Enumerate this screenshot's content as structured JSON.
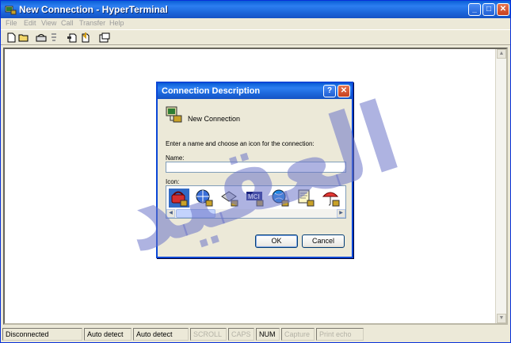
{
  "window": {
    "title": "New Connection - HyperTerminal",
    "minimize": "_",
    "maximize": "□",
    "close": "✕"
  },
  "menu": [
    "File",
    "Edit",
    "View",
    "Call",
    "Transfer",
    "Help"
  ],
  "toolbar": [
    "new-icon",
    "open-icon",
    "dial-icon",
    "disconnect-icon",
    "send-icon",
    "receive-icon",
    "properties-icon"
  ],
  "dialog": {
    "title": "Connection Description",
    "help": "?",
    "close": "✕",
    "connection_name": "New Connection",
    "prompt": "Enter a name and choose an icon for the connection:",
    "name_label": "Name:",
    "name_value": "",
    "icon_label": "Icon:",
    "icons": [
      "phone-red-icon",
      "globe-icon",
      "fax-icon",
      "mci-icon",
      "globe-blue-icon",
      "document-icon",
      "umbrella-icon"
    ],
    "ok_label": "OK",
    "cancel_label": "Cancel"
  },
  "status": {
    "connection": "Disconnected",
    "detect1": "Auto detect",
    "detect2": "Auto detect",
    "scroll": "SCROLL",
    "caps": "CAPS",
    "num": "NUM",
    "capture": "Capture",
    "print_echo": "Print echo"
  },
  "watermark_text": "العقيد",
  "colors": {
    "titlebar": "#1b64d8",
    "watermark": "#6b74c9"
  }
}
